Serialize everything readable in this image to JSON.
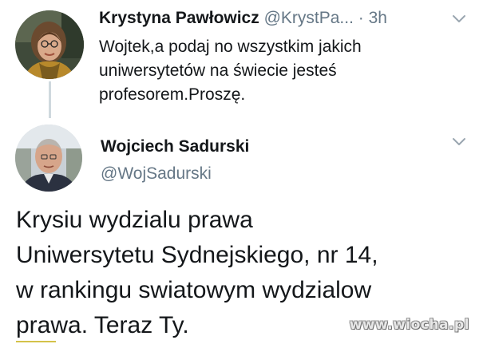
{
  "tweet1": {
    "author_name": "Krystyna Pawłowicz",
    "handle": "@KrystPa...",
    "dot": "·",
    "time": "3h",
    "text_lines": [
      "Wojtek,a podaj no wszystkim jakich",
      "uniwersytetów na świecie jesteś",
      "profesorem.Proszę."
    ],
    "menu_icon": "chevron-down-icon"
  },
  "tweet2": {
    "author_name": "Wojciech Sadurski",
    "handle": "@WojSadurski",
    "text_lines": [
      "Krysiu wydzialu prawa",
      "Uniwersytetu Sydnejskiego, nr 14,",
      "w rankingu swiatowym wydzialow",
      "prawa. Teraz Ty."
    ],
    "menu_icon": "chevron-down-icon"
  },
  "watermark": {
    "text": "www.wiocha.pl"
  },
  "colors": {
    "text": "#14171a",
    "secondary_text": "#657786",
    "thread_line": "#cfd9de",
    "background": "#ffffff"
  }
}
